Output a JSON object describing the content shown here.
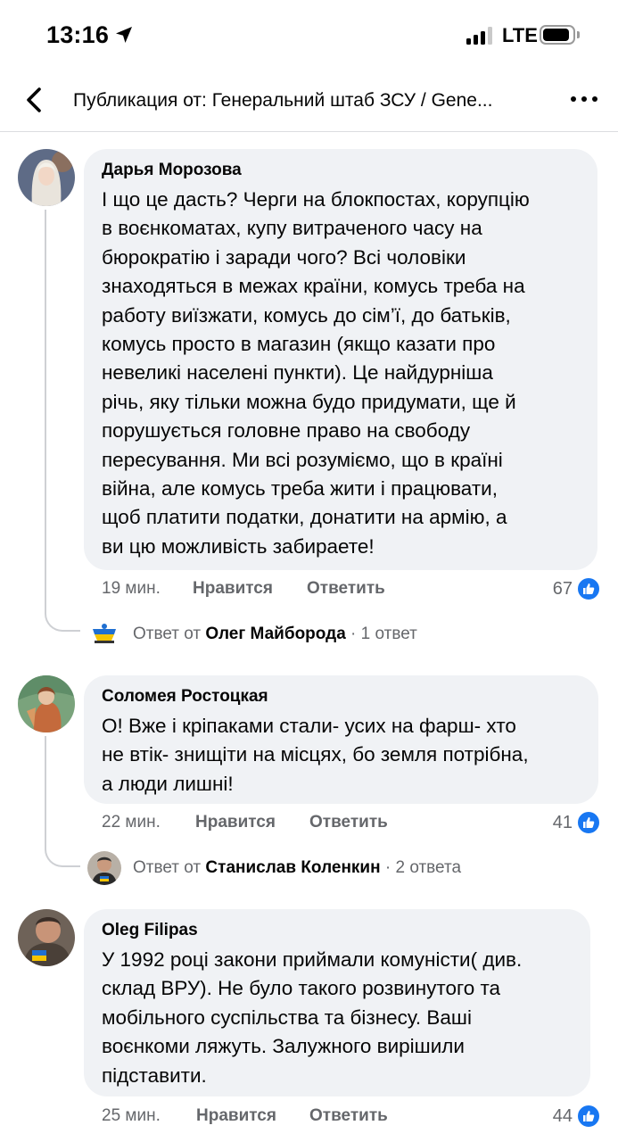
{
  "status_bar": {
    "time": "13:16",
    "network": "LTE",
    "icons": [
      "location-arrow-icon",
      "signal-icon",
      "battery-icon"
    ],
    "battery_level": 0.9
  },
  "header": {
    "title": "Публикация от: Генеральний штаб ЗСУ / Gene...",
    "icons": [
      "back-arrow-icon",
      "more-options-icon"
    ]
  },
  "comments": [
    {
      "author": "Дарья Морозова",
      "text": "І що це дасть? Черги на блокпостах, корупцію\nв воєнкоматах, купу витраченого часу на\nбюрократію і заради чого? Всі чоловіки\nзнаходяться в межах країни, комусь треба на\nработу виїзжати, комусь до сім’ї, до батьків,\nкомусь просто в магазин (якщо казати про\nневеликі населені пункти). Це найдурніша\nрічь, яку тільки можна будо придумати, ще й\nпорушується головне право на свободу\nпересування. Ми всі розуміємо, що в країні\nвійна, але комусь треба жити і працювати,\nщоб платити податки, донатити на армію, а\nви цю можливість забираете!",
      "time": "19 мин.",
      "like_label": "Нравится",
      "reply_label": "Ответить",
      "likes": "67",
      "reply_preview": {
        "prefix": "Ответ от",
        "name": "Олег Майборода",
        "suffix": "· 1 ответ"
      }
    },
    {
      "author": "Соломея Ростоцкая",
      "text": "О! Вже і кріпаками стали- усих на фарш- хто\nне втік- знищіти на місцях, бо земля потрібна,\nа люди лишні!",
      "time": "22 мин.",
      "like_label": "Нравится",
      "reply_label": "Ответить",
      "likes": "41",
      "reply_preview": {
        "prefix": "Ответ от",
        "name": "Станислав Коленкин",
        "suffix": "· 2 ответа"
      }
    },
    {
      "author": "Oleg Filipas",
      "text": "У 1992 році закони приймали комуністи( див.\nсклад ВРУ). Не було такого розвинутого та\nмобільного суспільства та бізнесу. Ваші\nвоєнкоми ляжуть. Залужного вирішили\nпідставити.",
      "time": "25 мин.",
      "like_label": "Нравится",
      "reply_label": "Ответить",
      "likes": "44"
    }
  ],
  "colors": {
    "bubble": "#f0f2f5",
    "meta_text": "#65676b",
    "like_blue": "#1877f2"
  }
}
